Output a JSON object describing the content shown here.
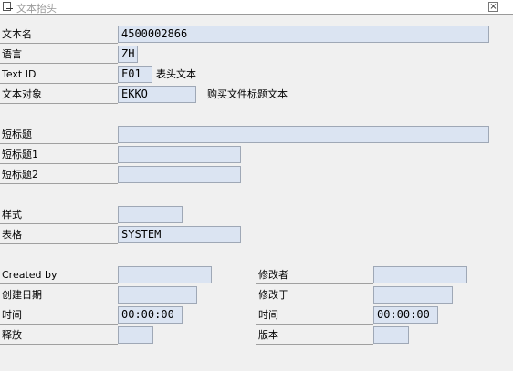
{
  "window": {
    "title": "文本抬头",
    "close_glyph": "×"
  },
  "header": {
    "text_name": {
      "label": "文本名",
      "value": "4500002866"
    },
    "language": {
      "label": "语言",
      "value": "ZH"
    },
    "text_id": {
      "label": "Text ID",
      "value": "F01",
      "description": "表头文本"
    },
    "text_object": {
      "label": "文本对象",
      "value": "EKKO",
      "description": "购买文件标题文本"
    }
  },
  "titles": {
    "short_title": {
      "label": "短标题",
      "value": ""
    },
    "short_title_1": {
      "label": "短标题1",
      "value": ""
    },
    "short_title_2": {
      "label": "短标题2",
      "value": ""
    }
  },
  "format": {
    "style": {
      "label": "样式",
      "value": ""
    },
    "form": {
      "label": "表格",
      "value": "SYSTEM"
    }
  },
  "admin": {
    "created_by": {
      "label": "Created by",
      "value": ""
    },
    "created_on": {
      "label": "创建日期",
      "value": ""
    },
    "created_time": {
      "label": "时间",
      "value": "00:00:00"
    },
    "release": {
      "label": "释放",
      "value": ""
    },
    "changed_by": {
      "label": "修改者",
      "value": ""
    },
    "changed_on": {
      "label": "修改于",
      "value": ""
    },
    "changed_time": {
      "label": "时间",
      "value": "00:00:00"
    },
    "version": {
      "label": "版本",
      "value": ""
    }
  }
}
